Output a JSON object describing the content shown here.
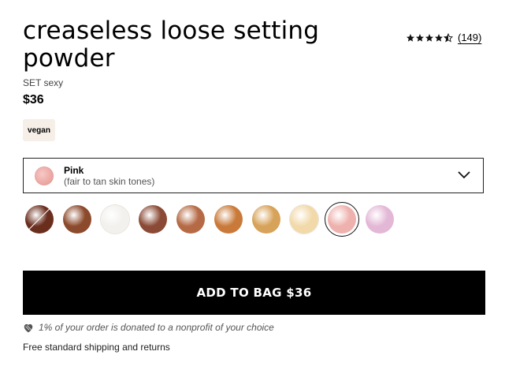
{
  "product": {
    "title": "creaseless loose setting powder",
    "subtitle": "SET sexy",
    "price": "$36",
    "badge": "vegan"
  },
  "rating": {
    "stars": 4.5,
    "count": "(149)"
  },
  "shade": {
    "name": "Pink",
    "description": "(fair to tan skin tones)"
  },
  "swatches": [
    {
      "name": "shade-1",
      "color": "#6a2e1e",
      "unavailable": true
    },
    {
      "name": "shade-2",
      "color": "#8c4a2c"
    },
    {
      "name": "shade-3",
      "color": "#f2f1ee"
    },
    {
      "name": "shade-4",
      "color": "#8b4a35"
    },
    {
      "name": "shade-5",
      "color": "#b56a45"
    },
    {
      "name": "shade-6",
      "color": "#c97a3a"
    },
    {
      "name": "shade-7",
      "color": "#d7a259"
    },
    {
      "name": "shade-8",
      "color": "#f2d9a9"
    },
    {
      "name": "shade-9",
      "color": "#eeb1ad",
      "selected": true
    },
    {
      "name": "shade-10",
      "color": "#e3b8d6"
    }
  ],
  "cta": {
    "label": "ADD TO BAG $36"
  },
  "donation": {
    "text": "1% of your order is donated to a nonprofit of your choice"
  },
  "shipping": {
    "text": "Free standard shipping and returns"
  }
}
